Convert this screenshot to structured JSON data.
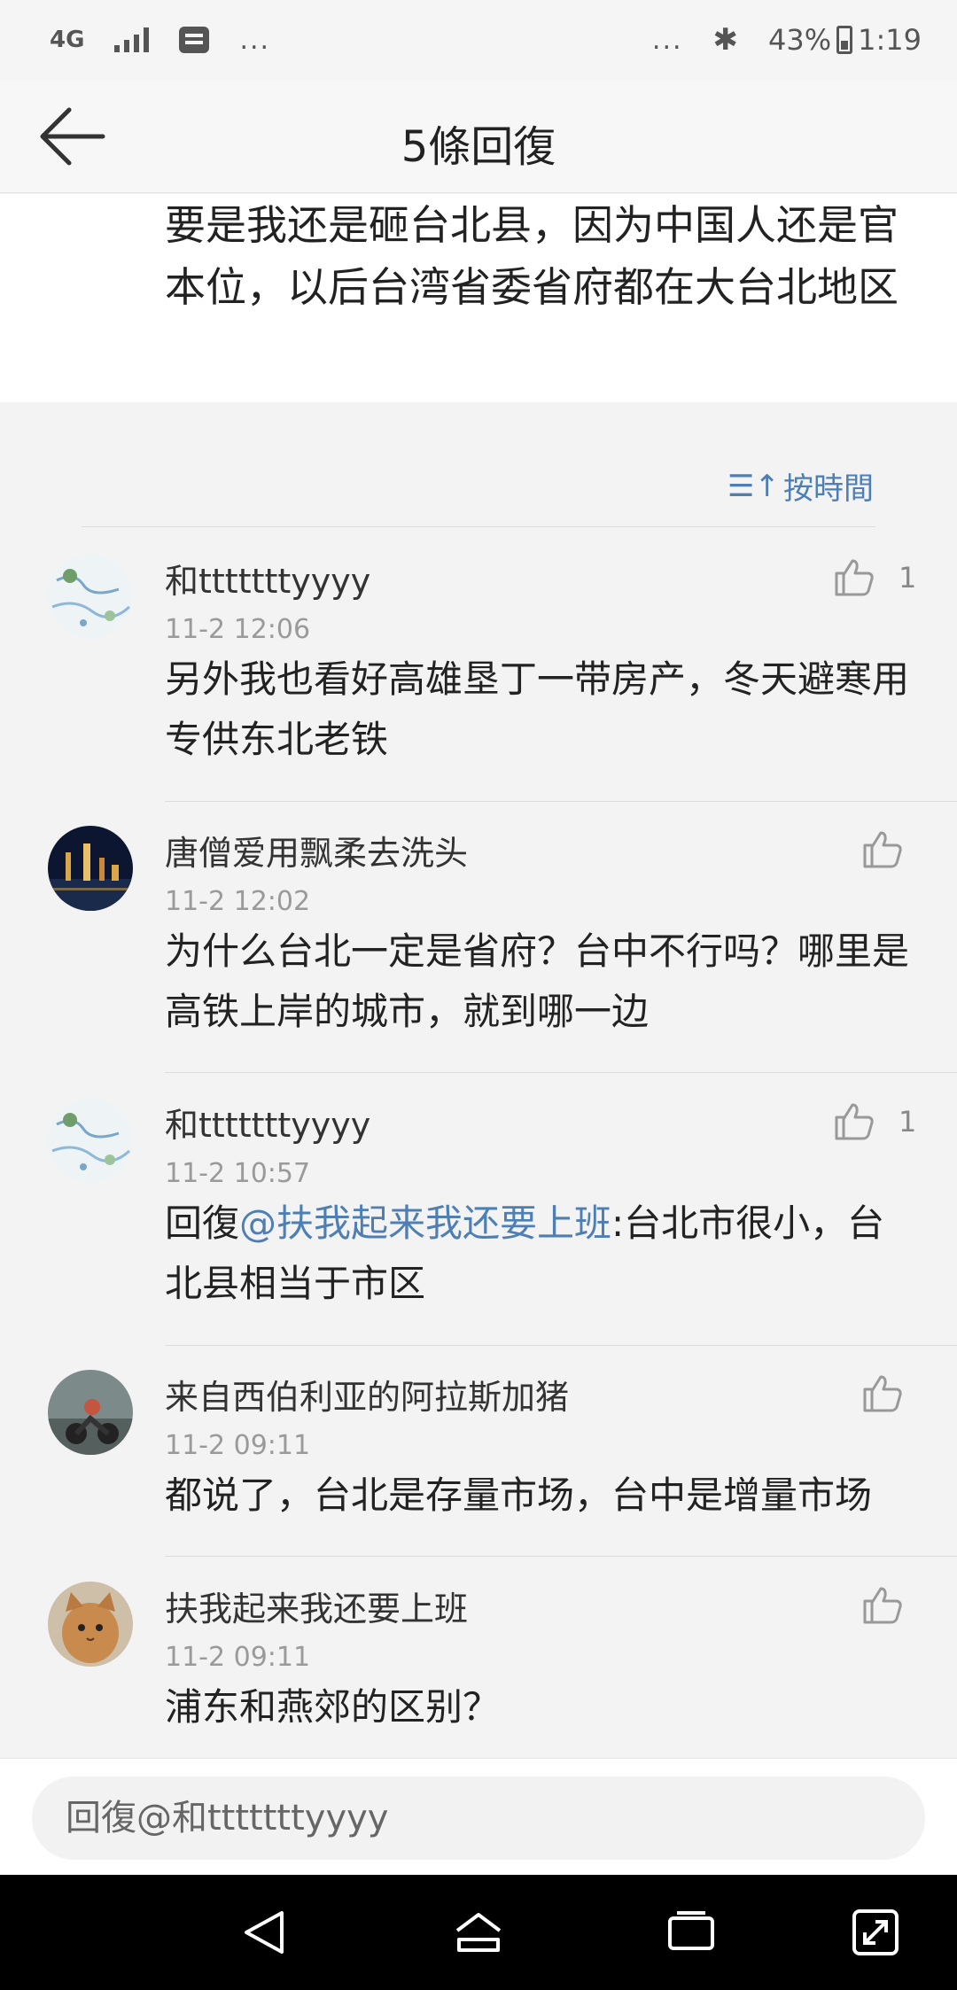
{
  "status_bar": {
    "network": "4G",
    "overflow": "...",
    "right_overflow": "...",
    "battery": "43%",
    "time": "1:19"
  },
  "header": {
    "back_icon": "back-arrow-icon",
    "title": "5條回復"
  },
  "post": {
    "text": "要是我还是砸台北县，因为中国人还是官本位，以后台湾省委省府都在大台北地区"
  },
  "sort": {
    "icon": "sort-ascending-icon",
    "label": "按時間"
  },
  "comments": [
    {
      "name": "和tttttttyyyy",
      "time": "11-2 12:06",
      "prefix": "",
      "mention": "",
      "text": "另外我也看好高雄垦丁一带房产，冬天避寒用专供东北老铁",
      "likes": "1"
    },
    {
      "name": "唐僧爱用飘柔去洗头",
      "time": "11-2 12:02",
      "prefix": "",
      "mention": "",
      "text": "为什么台北一定是省府？台中不行吗？哪里是高铁上岸的城市，就到哪一边",
      "likes": ""
    },
    {
      "name": "和tttttttyyyy",
      "time": "11-2 10:57",
      "prefix": "回復",
      "mention": "@扶我起来我还要上班",
      "text": ":台北市很小，台北县相当于市区",
      "likes": "1"
    },
    {
      "name": "来自西伯利亚的阿拉斯加猪",
      "time": "11-2 09:11",
      "prefix": "",
      "mention": "",
      "text": "都说了，台北是存量市场，台中是增量市场",
      "likes": ""
    },
    {
      "name": "扶我起来我还要上班",
      "time": "11-2 09:11",
      "prefix": "",
      "mention": "",
      "text": "浦东和燕郊的区别？",
      "likes": ""
    }
  ],
  "reply": {
    "placeholder": "回復@和tttttttyyyy"
  },
  "nav": {
    "back": "nav-back-icon",
    "home": "nav-home-icon",
    "recents": "nav-recents-icon",
    "expand": "nav-expand-icon"
  },
  "colors": {
    "accent": "#4e7fb4",
    "background": "#f3f3f3",
    "text": "#222222",
    "muted": "#9a9a9a"
  }
}
